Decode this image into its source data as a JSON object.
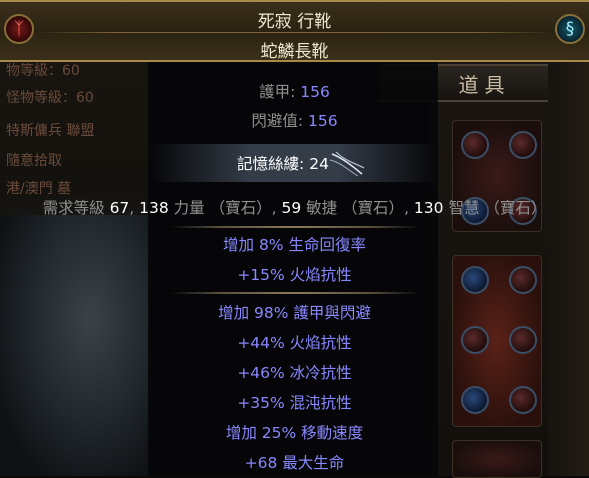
{
  "item": {
    "name": "死寂 行靴",
    "base_type": "蛇鱗長靴"
  },
  "background": {
    "stash_tab_label": "道具",
    "left_ghost_lines": [
      "物等級：60",
      "怪物等級：60",
      "特斯傭兵 聯盟",
      "隨意拾取",
      "港/澳門  墓"
    ]
  },
  "properties": [
    {
      "label": "護甲: ",
      "value": "156"
    },
    {
      "label": "閃避值: ",
      "value": "156"
    }
  ],
  "memory_strands": {
    "label": "記憶絲縷: ",
    "value": "24"
  },
  "requirements": {
    "prefix": "需求等級 ",
    "level": "67",
    "sep1": ", ",
    "str_value": "138",
    "str_label": " 力量 （寶石）",
    "sep2": ", ",
    "dex_value": "59",
    "dex_label": " 敏捷 （寶石）",
    "sep3": ", ",
    "int_value": "130",
    "int_label": " 智慧 （寶石）"
  },
  "implicit_mods": [
    "增加 8% 生命回復率",
    "+15% 火焰抗性"
  ],
  "explicit_mods": [
    "增加 98% 護甲與閃避",
    "+44% 火焰抗性",
    "+46% 冰冷抗性",
    "+35% 混沌抗性",
    "增加 25% 移動速度",
    "+68 最大生命"
  ],
  "colors": {
    "header_border": "#a88a48",
    "item_name": "#efe9d0",
    "magic_mod": "#8888ff",
    "label_grey": "#8f8f8f",
    "value_white": "#ffffff"
  },
  "icons": {
    "left_emblem": "rune-emblem-icon",
    "right_emblem": "swirl-emblem-icon",
    "memory": "memory-strands-icon"
  }
}
